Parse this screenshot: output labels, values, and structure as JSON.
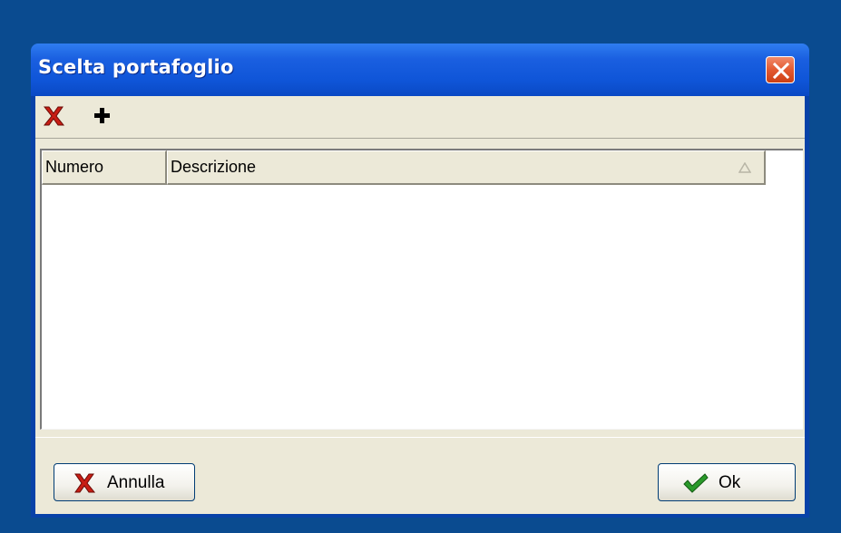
{
  "window": {
    "title": "Scelta portafoglio"
  },
  "toolbar": {
    "delete_icon": "red-x-icon",
    "add_icon": "plus-icon"
  },
  "list": {
    "columns": [
      "Numero",
      "Descrizione"
    ],
    "sorted_column": "Descrizione",
    "sort_direction": "ascending",
    "rows": []
  },
  "buttons": {
    "cancel_label": "Annulla",
    "ok_label": "Ok"
  },
  "colors": {
    "titlebar": "#0a49c4",
    "desktop": "#0a4b90",
    "close_button": "#e35a31",
    "cancel_icon": "#c81e14",
    "ok_icon": "#2a9a2a"
  }
}
